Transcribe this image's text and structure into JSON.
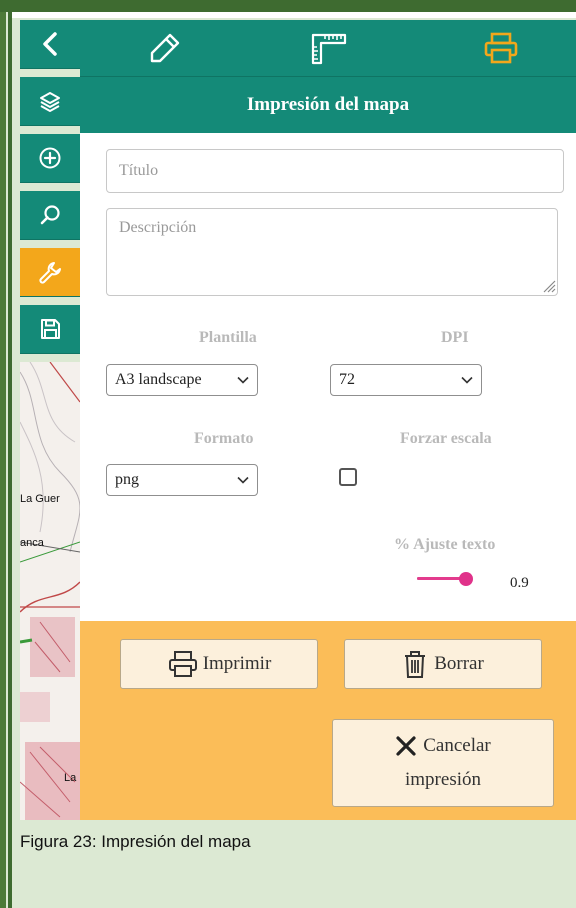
{
  "rail": {
    "items": [
      {
        "icon": "back-chevron-icon"
      },
      {
        "icon": "layers-icon"
      },
      {
        "icon": "add-circle-icon"
      },
      {
        "icon": "search-icon"
      },
      {
        "icon": "wrench-icon",
        "active": true
      },
      {
        "icon": "save-icon"
      }
    ],
    "map_labels": [
      "La Guer",
      "anca",
      "La"
    ]
  },
  "toolbar": {
    "tools": [
      {
        "icon": "pencil-icon"
      },
      {
        "icon": "ruler-icon"
      },
      {
        "icon": "printer-icon",
        "active": true
      }
    ]
  },
  "panel": {
    "title": "Impresión del mapa",
    "title_placeholder": "Título",
    "description_placeholder": "Descripción",
    "template_label": "Plantilla",
    "template_value": "A3 landscape",
    "dpi_label": "DPI",
    "dpi_value": "72",
    "format_label": "Formato",
    "format_value": "png",
    "force_scale_label": "Forzar escala",
    "force_scale_checked": false,
    "text_adjust_label": "% Ajuste texto",
    "text_adjust_value": "0.9"
  },
  "actions": {
    "print_label": "Imprimir",
    "clear_label": "Borrar",
    "cancel_line1": "Cancelar",
    "cancel_line2": "impresión"
  },
  "caption": "Figura 23: Impresión del mapa",
  "colors": {
    "teal": "#148a78",
    "orange_active": "#f3a71b",
    "action_bg": "#fbbd58",
    "slider": "#e0328a"
  }
}
